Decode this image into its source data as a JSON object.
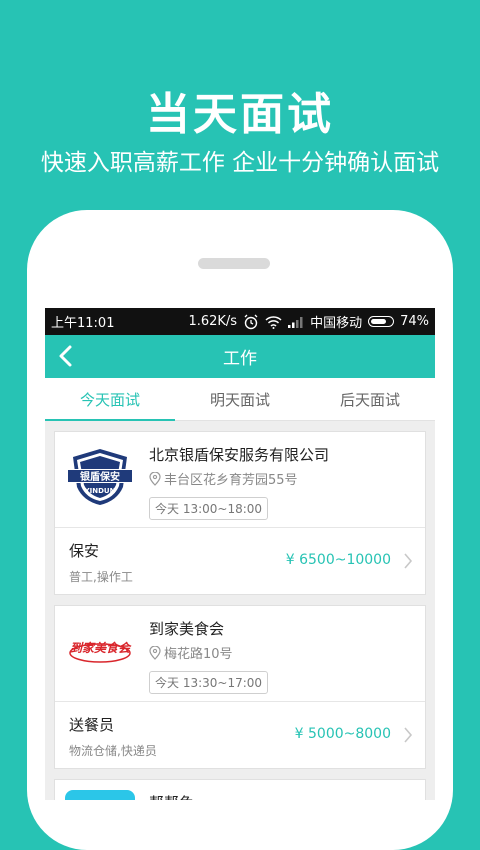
{
  "promo": {
    "headline": "当天面试",
    "subline": "快速入职高薪工作 企业十分钟确认面试"
  },
  "status_bar": {
    "time": "上午11:01",
    "speed": "1.62K/s",
    "carrier": "中国移动",
    "battery": "74%",
    "battery_level": 0.74
  },
  "app_bar": {
    "title": "工作"
  },
  "tabs": [
    {
      "label": "今天面试",
      "active": true
    },
    {
      "label": "明天面试",
      "active": false
    },
    {
      "label": "后天面试",
      "active": false
    }
  ],
  "jobs": [
    {
      "company": "北京银盾保安服务有限公司",
      "address": "丰台区花乡育芳园55号",
      "time": "今天 13:00~18:00",
      "position": "保安",
      "tags": "普工,操作工",
      "salary": "¥ 6500~10000",
      "logo_text_top": "银盾保安",
      "logo_text_bottom": "YINDUN"
    },
    {
      "company": "到家美食会",
      "address": "梅花路10号",
      "time": "今天 13:30~17:00",
      "position": "送餐员",
      "tags": "物流仓储,快递员",
      "salary": "¥ 5000~8000",
      "logo_text": "到家美食会"
    },
    {
      "company": "帮帮兔"
    }
  ],
  "colors": {
    "accent": "#27c3b4",
    "status_bar": "#111111",
    "logo_red": "#d9262c",
    "logo_blue": "#1f3a7a"
  }
}
